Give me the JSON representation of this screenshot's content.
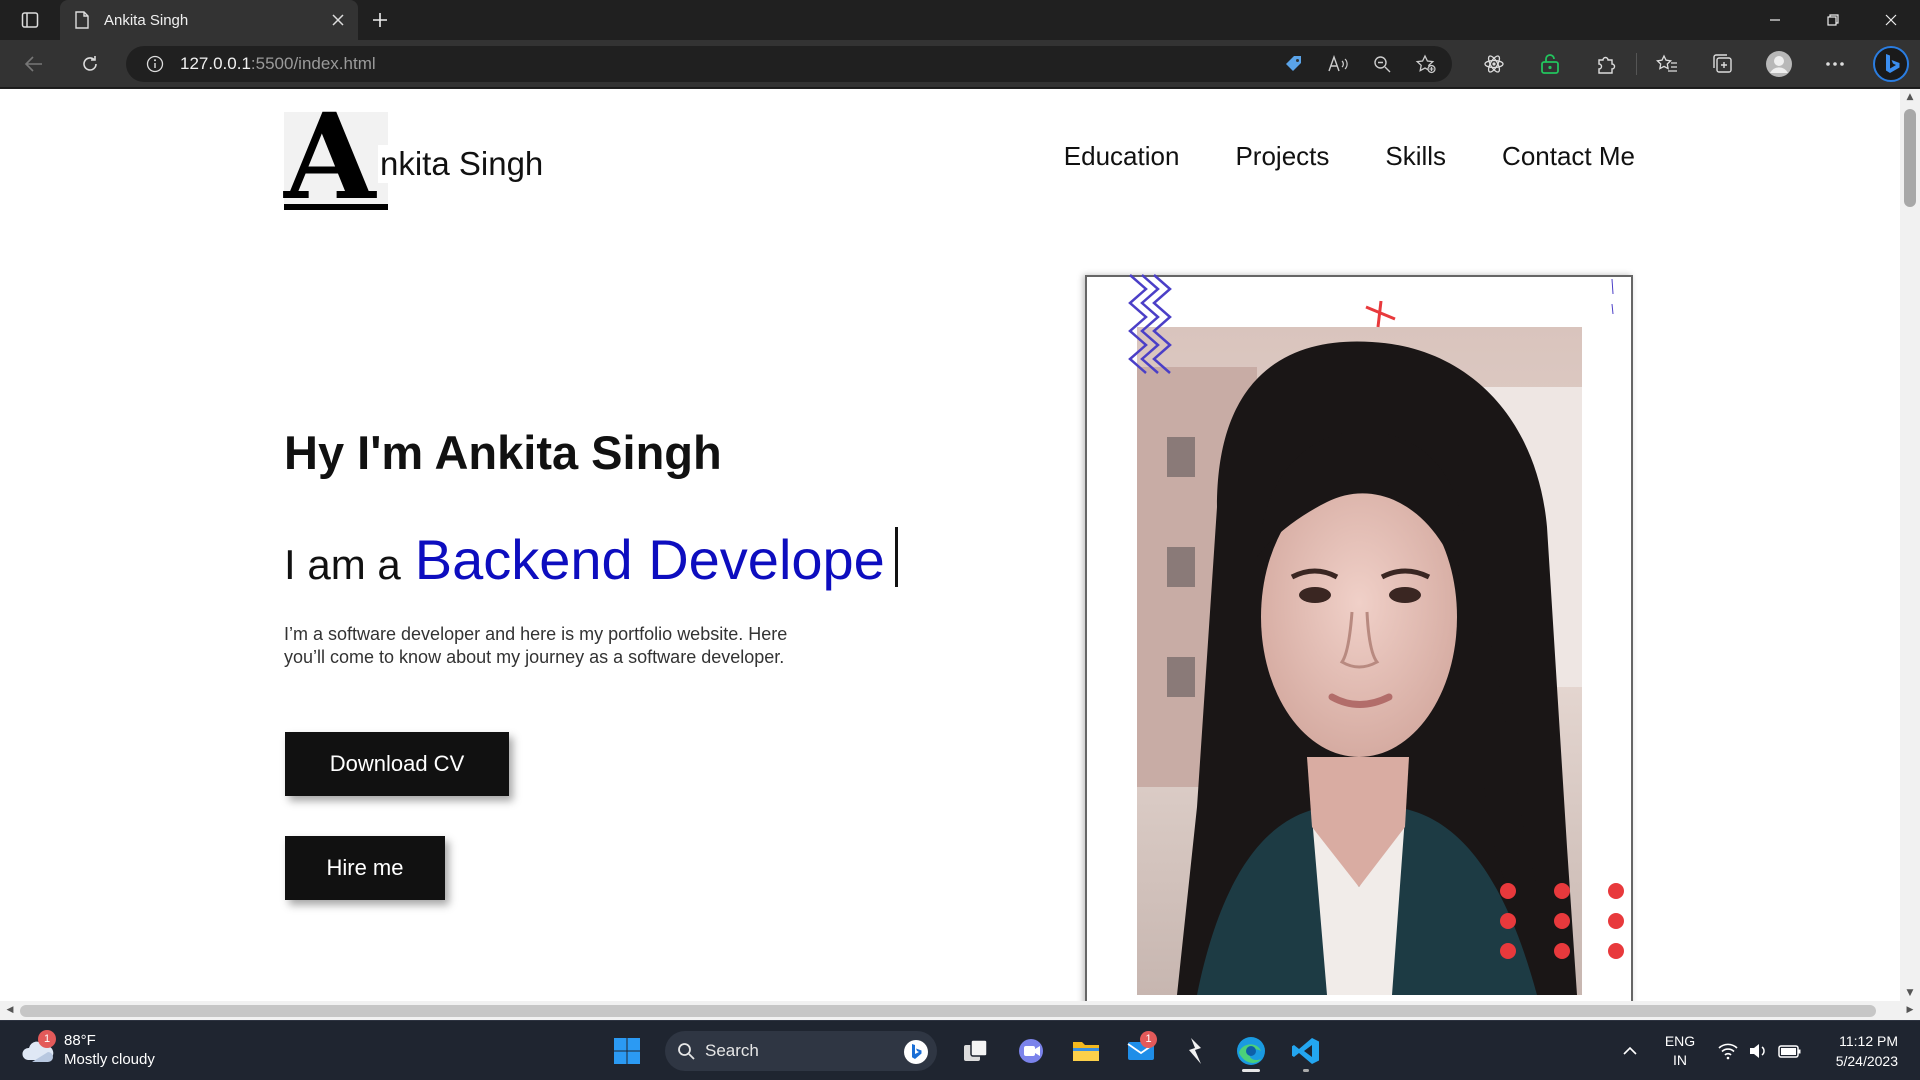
{
  "browser": {
    "tab_title": "Ankita Singh",
    "url_host": "127.0.0.1",
    "url_rest": ":5500/index.html"
  },
  "page": {
    "logo_letter": "A",
    "logo_text": "nkita Singh",
    "nav": [
      "Education",
      "Projects",
      "Skills",
      "Contact Me"
    ],
    "greeting": "Hy I'm Ankita Singh",
    "role_prefix": "I am a",
    "role": "Backend Develope",
    "intro": "I’m a software developer and here is my portfolio website. Here you’ll come to know about my journey as a software developer.",
    "btn_cv": "Download CV",
    "btn_hire": "Hire me"
  },
  "taskbar": {
    "weather_temp": "88°F",
    "weather_desc": "Mostly cloudy",
    "weather_badge": "1",
    "search_label": "Search",
    "mail_badge": "1",
    "lang_top": "ENG",
    "lang_bottom": "IN",
    "time": "11:12 PM",
    "date": "5/24/2023"
  },
  "colors": {
    "accent_blue": "#0d0dbf",
    "deco_red": "#e8393c",
    "deco_purple": "#4b3fc7"
  }
}
